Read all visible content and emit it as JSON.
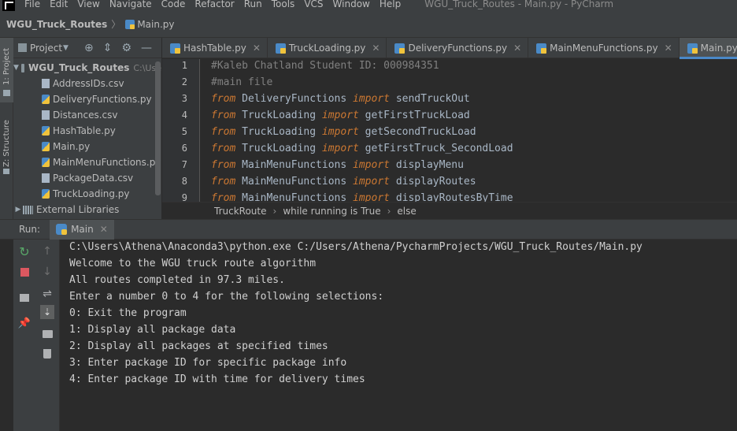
{
  "menubar": {
    "items": [
      "File",
      "Edit",
      "View",
      "Navigate",
      "Code",
      "Refactor",
      "Run",
      "Tools",
      "VCS",
      "Window",
      "Help"
    ],
    "window_title": "WGU_Truck_Routes - Main.py - PyCharm"
  },
  "navbar": {
    "project": "WGU_Truck_Routes",
    "file": "Main.py"
  },
  "toolstrip": {
    "project_tab": "1: Project",
    "structure_tab": "Z: Structure"
  },
  "project_panel": {
    "title": "Project",
    "root": {
      "name": "WGU_Truck_Routes",
      "path": "C:\\Use"
    },
    "files": [
      {
        "name": "AddressIDs.csv",
        "type": "csv"
      },
      {
        "name": "DeliveryFunctions.py",
        "type": "py"
      },
      {
        "name": "Distances.csv",
        "type": "csv"
      },
      {
        "name": "HashTable.py",
        "type": "py"
      },
      {
        "name": "Main.py",
        "type": "py"
      },
      {
        "name": "MainMenuFunctions.py",
        "type": "py"
      },
      {
        "name": "PackageData.csv",
        "type": "csv"
      },
      {
        "name": "TruckLoading.py",
        "type": "py"
      }
    ],
    "external": "External Libraries"
  },
  "editor": {
    "tabs": [
      "HashTable.py",
      "TruckLoading.py",
      "DeliveryFunctions.py",
      "MainMenuFunctions.py",
      "Main.py"
    ],
    "active_tab": "Main.py",
    "line_numbers": [
      "1",
      "2",
      "3",
      "4",
      "5",
      "6",
      "7",
      "8",
      "9"
    ],
    "lines": [
      {
        "kind": "comment",
        "text": "#Kaleb Chatland Student ID: 000984351"
      },
      {
        "kind": "comment",
        "text": "#main file"
      },
      {
        "kind": "import",
        "from": "from",
        "module": " DeliveryFunctions ",
        "imp": "import",
        "name": " sendTruckOut"
      },
      {
        "kind": "import",
        "from": "from",
        "module": " TruckLoading ",
        "imp": "import",
        "name": " getFirstTruckLoad"
      },
      {
        "kind": "import",
        "from": "from",
        "module": " TruckLoading ",
        "imp": "import",
        "name": " getSecondTruckLoad"
      },
      {
        "kind": "import",
        "from": "from",
        "module": " TruckLoading ",
        "imp": "import",
        "name": " getFirstTruck_SecondLoad"
      },
      {
        "kind": "import",
        "from": "from",
        "module": " MainMenuFunctions ",
        "imp": "import",
        "name": " displayMenu"
      },
      {
        "kind": "import",
        "from": "from",
        "module": " MainMenuFunctions ",
        "imp": "import",
        "name": " displayRoutes"
      },
      {
        "kind": "import",
        "from": "from",
        "module": " MainMenuFunctions ",
        "imp": "import",
        "name": " displayRoutesByTime"
      }
    ],
    "crumbs": [
      "TruckRoute",
      "while running is True",
      "else"
    ]
  },
  "run": {
    "label": "Run:",
    "tab": "Main",
    "console": [
      "C:\\Users\\Athena\\Anaconda3\\python.exe C:/Users/Athena/PycharmProjects/WGU_Truck_Routes/Main.py",
      "Welcome to the WGU truck route algorithm",
      "All routes completed in 97.3 miles.",
      "Enter a number 0 to 4 for the following selections:",
      "0: Exit the program",
      "1: Display all package data",
      "2: Display all packages at specified times",
      "3: Enter package ID for specific package info",
      "4: Enter package ID with time for delivery times"
    ]
  },
  "colors": {
    "background": "#2b2b2b",
    "panel": "#3c3f41",
    "keyword": "#cc7832",
    "comment": "#808080",
    "accent": "#4a88c7"
  }
}
